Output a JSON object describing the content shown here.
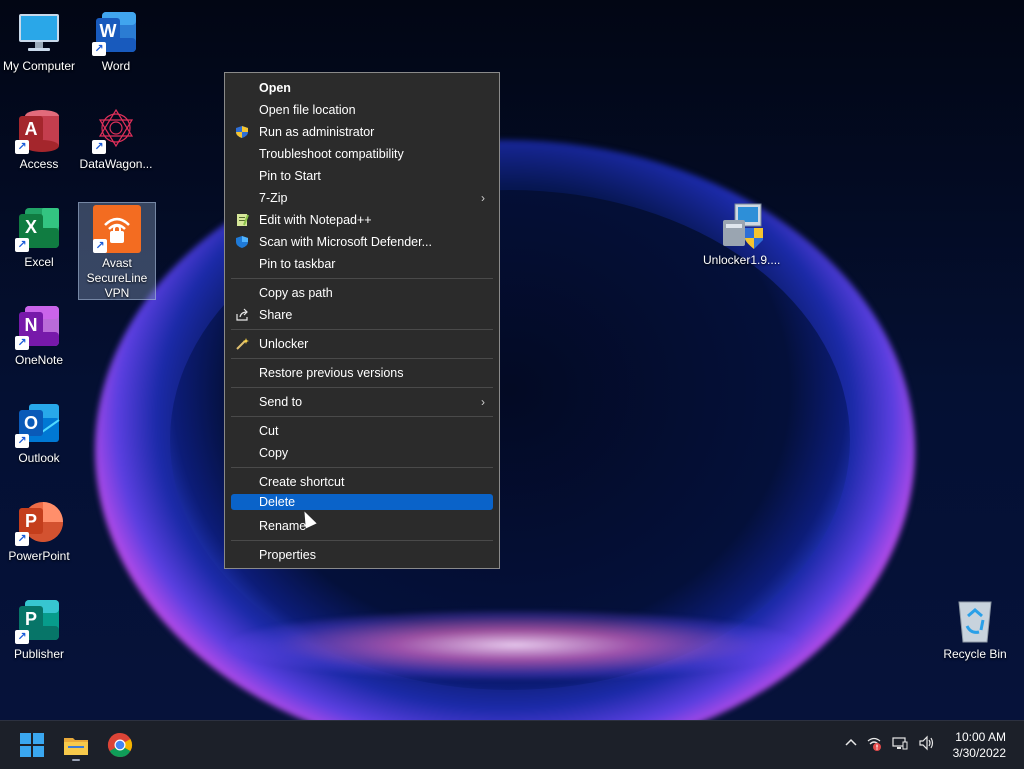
{
  "desktop_icons": [
    {
      "label": "My Computer"
    },
    {
      "label": "Word"
    },
    {
      "label": "Access"
    },
    {
      "label": "DataWagon..."
    },
    {
      "label": "Excel"
    },
    {
      "label": "Avast SecureLine VPN"
    },
    {
      "label": "OneNote"
    },
    {
      "label": "Outlook"
    },
    {
      "label": "PowerPoint"
    },
    {
      "label": "Publisher"
    },
    {
      "label": "Unlocker1.9...."
    },
    {
      "label": "Recycle Bin"
    }
  ],
  "icon_letters": {
    "word": "W",
    "access": "A",
    "excel": "X",
    "onenote": "N",
    "outlook": "O",
    "powerpoint": "P",
    "publisher": "P"
  },
  "context_menu": {
    "items": [
      {
        "label": "Open",
        "icon": ""
      },
      {
        "label": "Open file location",
        "icon": ""
      },
      {
        "label": "Run as administrator",
        "icon": "uac-shield-icon"
      },
      {
        "label": "Troubleshoot compatibility",
        "icon": ""
      },
      {
        "label": "Pin to Start",
        "icon": ""
      },
      {
        "label": "7-Zip",
        "icon": "",
        "submenu": true
      },
      {
        "label": "Edit with Notepad++",
        "icon": "notepad-icon"
      },
      {
        "label": "Scan with Microsoft Defender...",
        "icon": "defender-icon"
      },
      {
        "label": "Pin to taskbar",
        "icon": ""
      },
      {
        "label": "Copy as path",
        "icon": ""
      },
      {
        "label": "Share",
        "icon": "share-icon"
      },
      {
        "label": "Unlocker",
        "icon": "wand-icon"
      },
      {
        "label": "Restore previous versions",
        "icon": ""
      },
      {
        "label": "Send to",
        "icon": "",
        "submenu": true
      },
      {
        "label": "Cut",
        "icon": ""
      },
      {
        "label": "Copy",
        "icon": ""
      },
      {
        "label": "Create shortcut",
        "icon": ""
      },
      {
        "label": "Delete",
        "icon": "",
        "highlighted": true
      },
      {
        "label": "Rename",
        "icon": ""
      },
      {
        "label": "Properties",
        "icon": ""
      }
    ]
  },
  "taskbar": {
    "clock_time": "10:00 AM",
    "clock_date": "3/30/2022"
  },
  "colors": {
    "highlight": "#0a63c9",
    "menu_bg": "#2b2b2b",
    "taskbar_bg": "#1c2029"
  }
}
